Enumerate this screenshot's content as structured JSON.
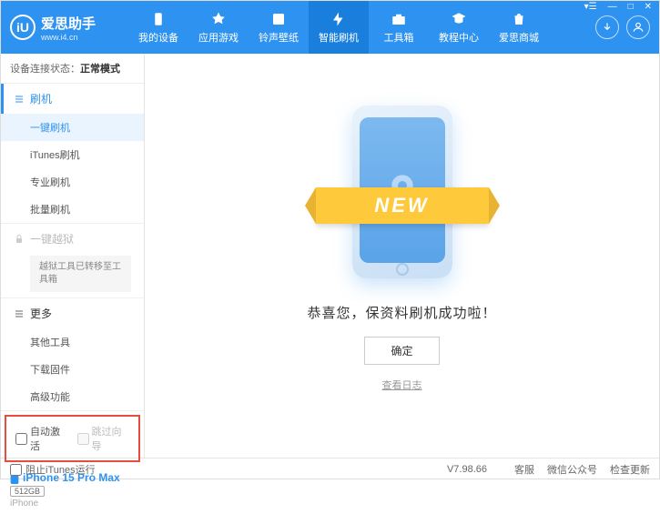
{
  "header": {
    "app_name": "爱思助手",
    "app_url": "www.i4.cn",
    "nav": [
      {
        "label": "我的设备"
      },
      {
        "label": "应用游戏"
      },
      {
        "label": "铃声壁纸"
      },
      {
        "label": "智能刷机"
      },
      {
        "label": "工具箱"
      },
      {
        "label": "教程中心"
      },
      {
        "label": "爱思商城"
      }
    ]
  },
  "sidebar": {
    "status_label": "设备连接状态：",
    "status_value": "正常模式",
    "flash_header": "刷机",
    "flash_items": [
      "一键刷机",
      "iTunes刷机",
      "专业刷机",
      "批量刷机"
    ],
    "jailbreak_header": "一键越狱",
    "jailbreak_note": "越狱工具已转移至工具箱",
    "more_header": "更多",
    "more_items": [
      "其他工具",
      "下载固件",
      "高级功能"
    ],
    "auto_activate": "自动激活",
    "skip_guide": "跳过向导",
    "device_name": "iPhone 15 Pro Max",
    "device_storage": "512GB",
    "device_type": "iPhone"
  },
  "main": {
    "new_badge": "NEW",
    "success_text": "恭喜您，保资料刷机成功啦！",
    "ok_button": "确定",
    "log_link": "查看日志"
  },
  "footer": {
    "block_itunes": "阻止iTunes运行",
    "version": "V7.98.66",
    "links": [
      "客服",
      "微信公众号",
      "检查更新"
    ]
  }
}
